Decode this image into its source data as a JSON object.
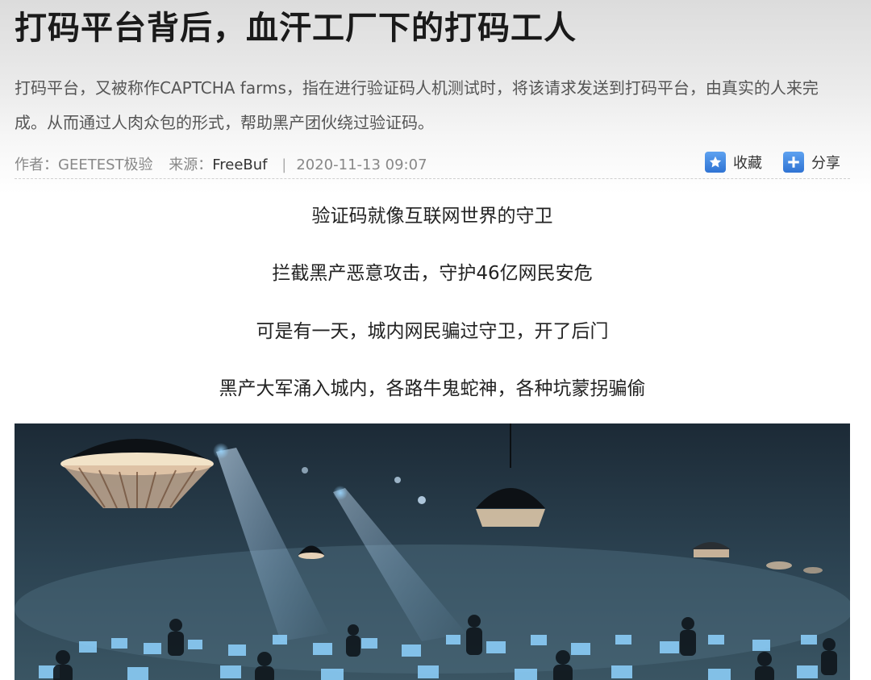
{
  "article": {
    "title": "打码平台背后，血汗工厂下的打码工人",
    "summary": "打码平台，又被称作CAPTCHA farms，指在进行验证码人机测试时，将该请求发送到打码平台，由真实的人来完成。从而通过人肉众包的形式，帮助黑产团伙绕过验证码。",
    "meta": {
      "author_label": "作者：",
      "author": "GEETEST极验",
      "source_label": "来源：",
      "source": "FreeBuf",
      "separator": "|",
      "datetime": "2020-11-13 09:07"
    },
    "actions": {
      "favorite_label": "收藏",
      "favorite_icon": "star-icon",
      "share_label": "分享",
      "share_icon": "plus-icon"
    },
    "body_lines": [
      "验证码就像互联网世界的守卫",
      "拦截黑产恶意攻击，守护46亿网民安危",
      "可是有一天，城内网民骗过守卫，开了后门",
      "黑产大军涌入城内，各路牛鬼蛇神，各种坑蒙拐骗偷"
    ],
    "image": {
      "subject": "dark-hall-rows-of-workers-at-computer-screens"
    }
  },
  "colors": {
    "title": "#1a1a1a",
    "summary": "#555555",
    "meta": "#888888",
    "icon_blue": "#2f73d3"
  }
}
